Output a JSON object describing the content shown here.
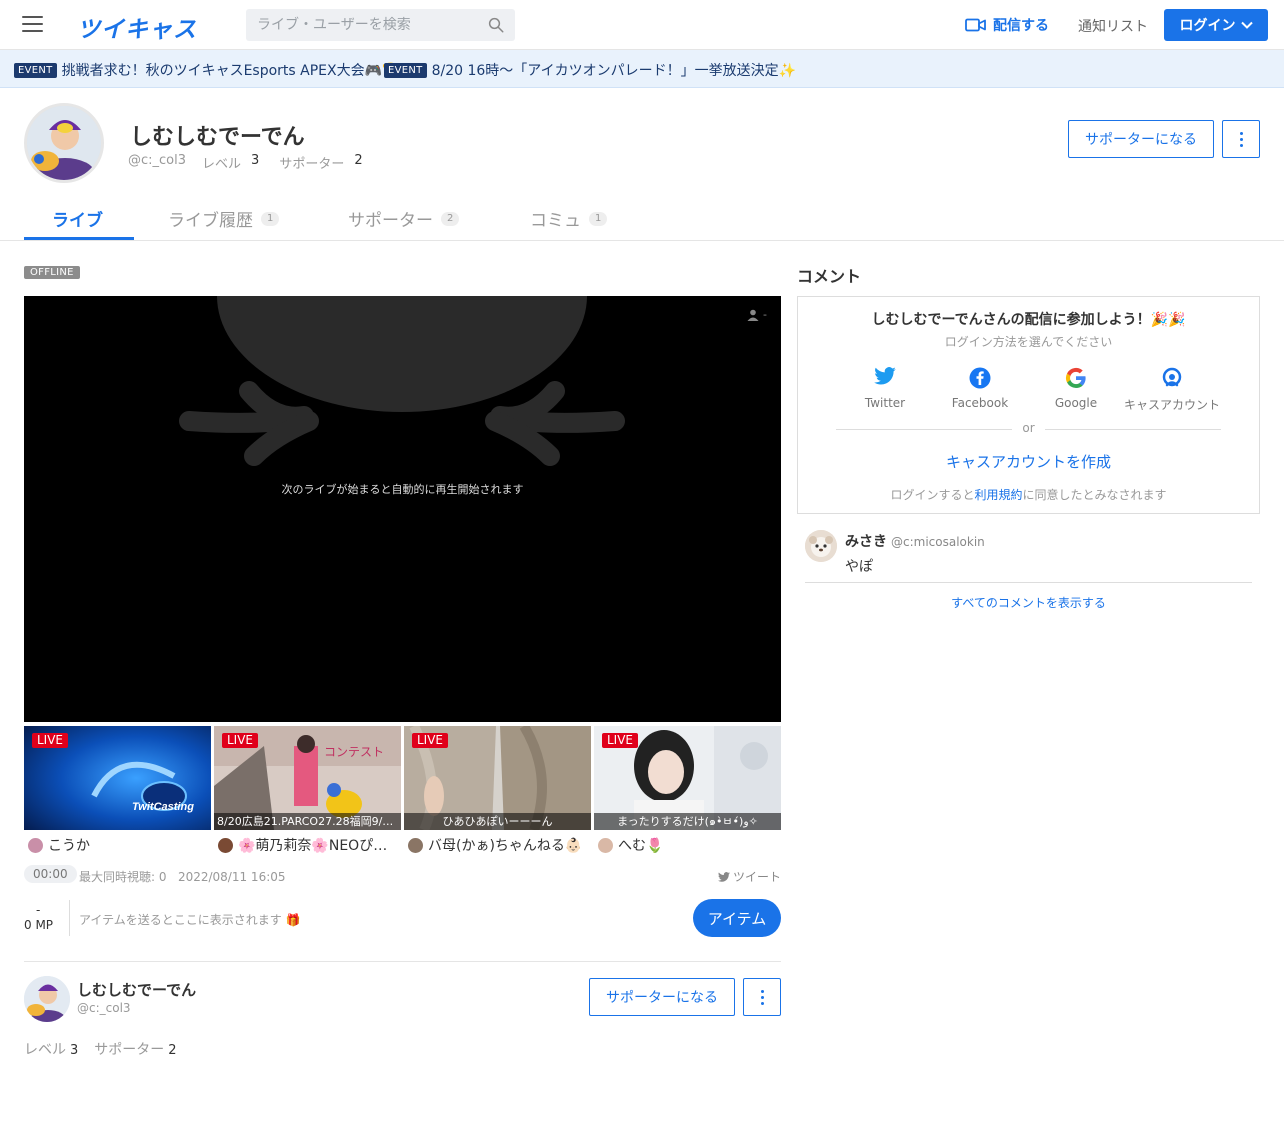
{
  "header": {
    "logo": "ツイキャス",
    "search_placeholder": "ライブ・ユーザーを検索",
    "broadcast_label": "配信する",
    "notify_label": "通知リスト",
    "login_label": "ログイン",
    "accent": "#1a73e8"
  },
  "events": [
    {
      "badge": "EVENT",
      "text": "挑戦者求む！秋のツイキャスEsports APEX大会🎮🏆"
    },
    {
      "badge": "EVENT",
      "text": "8/20 16時〜「アイカツオンパレード！」一挙放送決定✨"
    }
  ],
  "profile": {
    "name": "しむしむでーでん",
    "id": "@c:_col3",
    "level_label": "レベル",
    "level": "3",
    "supporter_label": "サポーター",
    "supporters": "2",
    "support_button": "サポーターになる"
  },
  "tabs": [
    {
      "label": "ライブ",
      "count": ""
    },
    {
      "label": "ライブ履歴",
      "count": "1"
    },
    {
      "label": "サポーター",
      "count": "2"
    },
    {
      "label": "コミュ",
      "count": "1"
    }
  ],
  "player": {
    "status": "OFFLINE",
    "message": "次のライブが始まると自動的に再生開始されます",
    "viewers": "-"
  },
  "live_thumbs": [
    {
      "badge": "LIVE",
      "title": "",
      "user": "こうか",
      "icon": "twitcasting-headphones-thumb"
    },
    {
      "badge": "LIVE",
      "title": "8/20広島21.PARCO27.28福岡9/23...",
      "user": "🌸萌乃莉奈🌸NEOぴぇ...",
      "icon": "cosplay-contest-thumb"
    },
    {
      "badge": "LIVE",
      "title": "ひあひあぽいーーーん",
      "user": "バ母(かぁ)ちゃんねる👶🏻",
      "icon": "hair-color-thumb"
    },
    {
      "badge": "LIVE",
      "title": "まったりするだけ(๑•̀ㅂ•́)و✧",
      "user": "へむ🌷",
      "icon": "portrait-thumb"
    }
  ],
  "stats": {
    "time": "00:00",
    "max_viewers": "最大同時視聴: 0",
    "date": "2022/08/11 16:05",
    "tweet": "ツイート"
  },
  "items": {
    "mp_dash": "-",
    "mp": "0 MP",
    "message": "アイテムを送るとここに表示されます 🎁",
    "button": "アイテム"
  },
  "bottom_profile": {
    "name": "しむしむでーでん",
    "id": "@c:_col3",
    "level_label": "レベル",
    "level": "3",
    "supporter_label": "サポーター",
    "supporters": "2",
    "support_button": "サポーターになる"
  },
  "comments": {
    "title": "コメント",
    "login_title": "しむしむでーでんさんの配信に参加しよう！🎉🎉",
    "login_sub": "ログイン方法を選んでください",
    "socials": [
      {
        "label": "Twitter",
        "icon": "twitter-icon"
      },
      {
        "label": "Facebook",
        "icon": "facebook-icon"
      },
      {
        "label": "Google",
        "icon": "google-icon"
      },
      {
        "label": "キャスアカウント",
        "icon": "cas-account-icon"
      }
    ],
    "or": "or",
    "create": "キャスアカウントを作成",
    "terms_pre": "ログインすると",
    "terms_link": "利用規約",
    "terms_post": "に同意したとみなされます",
    "list": [
      {
        "name": "みさき",
        "id": "@c:micosalokin",
        "text": "やぽ"
      }
    ],
    "show_all": "すべてのコメントを表示する"
  }
}
